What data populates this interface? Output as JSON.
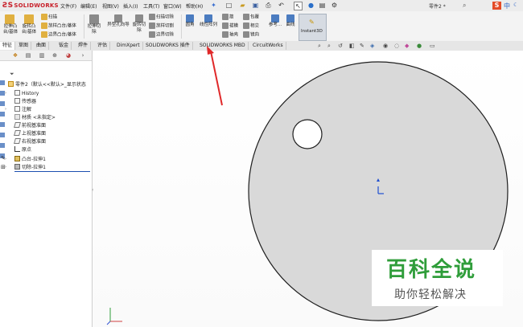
{
  "app": {
    "logo_text": "SOLIDWORKS",
    "document_title": "零件2 *"
  },
  "menu": [
    "文件(F)",
    "编辑(E)",
    "视图(V)",
    "插入(I)",
    "工具(T)",
    "窗口(W)",
    "帮助(H)"
  ],
  "features": {
    "extrude_boss": "拉伸凸台/基体",
    "revolve_boss": "旋转凸台/基体",
    "sweep": "扫描",
    "loft": "放样凸台/基体",
    "boundary_boss": "边界凸台/基体",
    "extrude_cut": "拉伸切除",
    "hole_wizard": "异型孔向导",
    "revolve_cut": "旋转切除",
    "swept_cut": "扫描切除",
    "lofted_cut": "放样切割",
    "boundary_cut": "边界切除",
    "fillet": "圆角",
    "linear_pattern": "线性阵列",
    "rib": "筋",
    "draft": "拔模",
    "shell": "抽壳",
    "wrap": "包覆",
    "intersect": "相交",
    "mirror": "镜向",
    "reference": "参考...",
    "curves": "曲线",
    "instant3d": "Instant3D"
  },
  "tabs": [
    "特征",
    "草图",
    "曲面",
    "钣金",
    "焊件",
    "评估",
    "DimXpert",
    "SOLIDWORKS 插件",
    "SOLIDWORKS MBD",
    "CircuitWorks"
  ],
  "tree": {
    "root": "零件2（默认<<默认>_显示状态",
    "items": [
      "History",
      "传感器",
      "注解",
      "材质 <未指定>",
      "前视基准面",
      "上视基准面",
      "右视基准面",
      "原点",
      "凸台-拉伸1",
      "切除-拉伸1"
    ]
  },
  "watermark": {
    "title": "百科全说",
    "subtitle": "助你轻松解决"
  },
  "colors": {
    "part_face": "#d9d9d9",
    "watermark_green": "#2f9d3a",
    "arrow_red": "#e0292a",
    "selection": "#1c4fb0"
  }
}
